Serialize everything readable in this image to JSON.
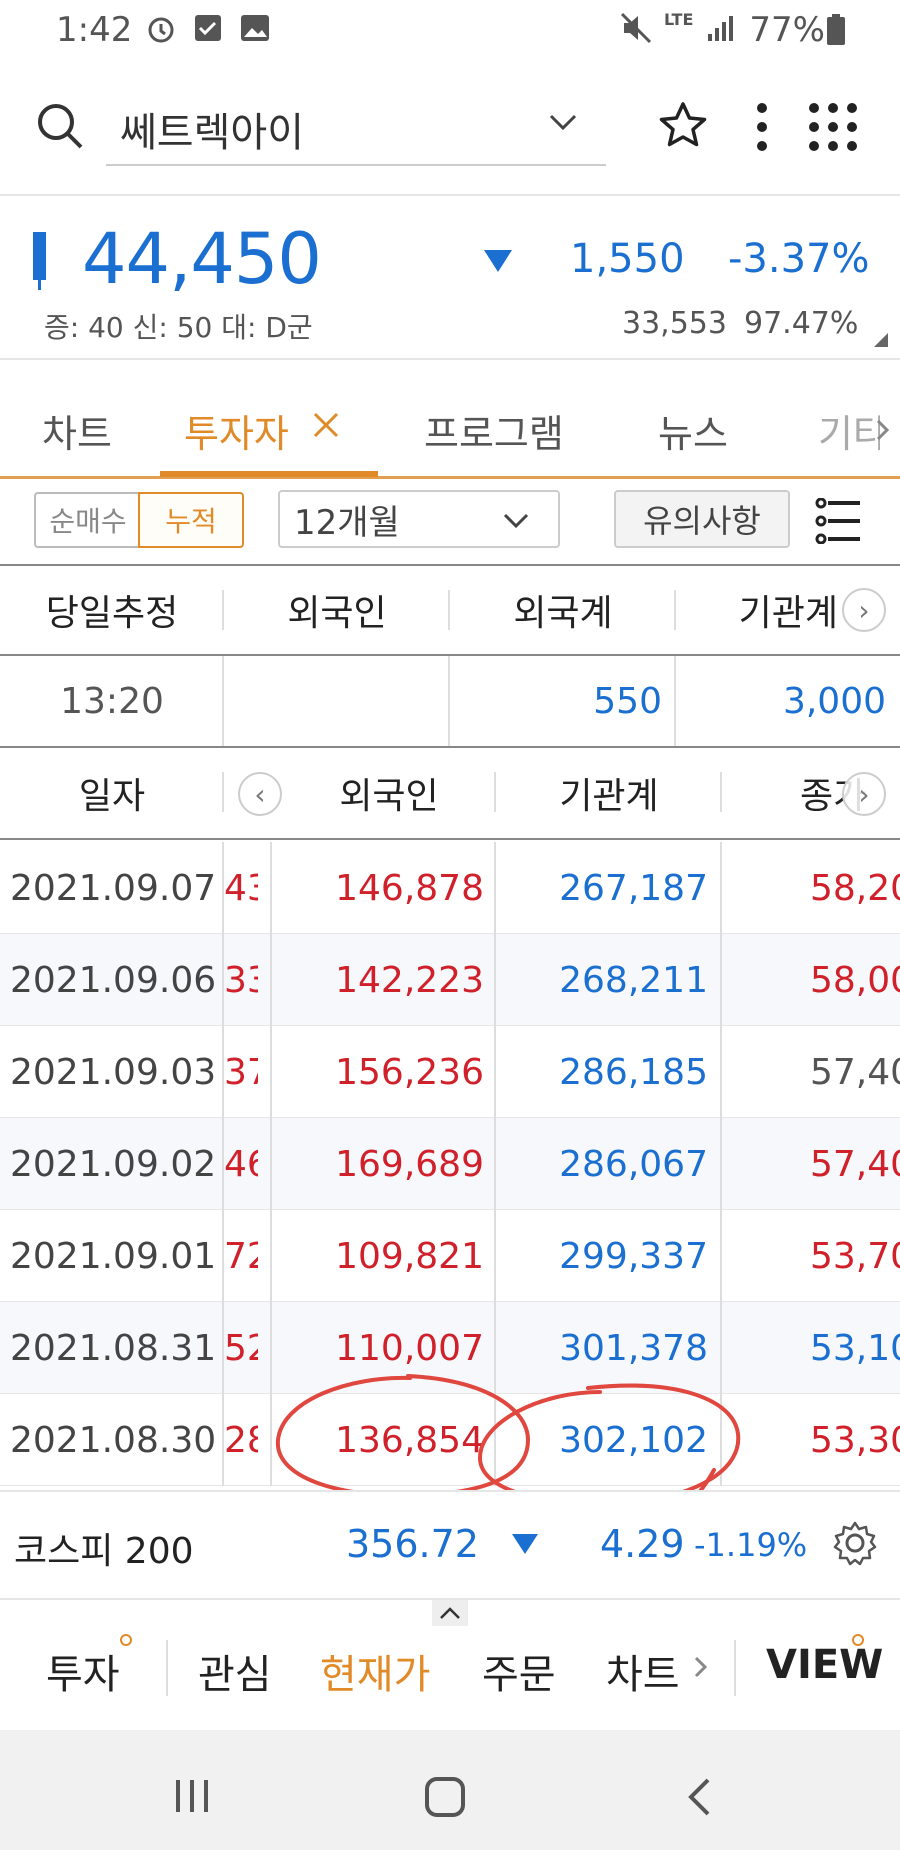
{
  "status_bar": {
    "time": "1:42",
    "network": "LTE",
    "battery": "77%"
  },
  "search": {
    "stock_name": "쎄트렉아이"
  },
  "price": {
    "current": "44,450",
    "change": "1,550",
    "change_pct": "-3.37%",
    "info": "증: 40 신: 50 대: D군",
    "volume": "33,553",
    "ratio": "97.47%"
  },
  "tabs": [
    {
      "label": "차트"
    },
    {
      "label": "투자자"
    },
    {
      "label": "프로그램"
    },
    {
      "label": "뉴스"
    },
    {
      "label": "기타"
    }
  ],
  "filters": {
    "seg_net": "순매수",
    "seg_cum": "누적",
    "period": "12개월",
    "notice": "유의사항"
  },
  "estimate": {
    "headers": [
      "당일추정",
      "외국인",
      "외국계",
      "기관계"
    ],
    "row": {
      "time": "13:20",
      "foreign": "",
      "foreign_firm": "550",
      "institution": "3,000"
    }
  },
  "history": {
    "headers": [
      "일자",
      "외국인",
      "기관계",
      "종가"
    ],
    "rows": [
      {
        "date": "2021.09.07",
        "prev": "43",
        "foreign": "146,878",
        "inst": "267,187",
        "close": "58,20"
      },
      {
        "date": "2021.09.06",
        "prev": "33",
        "foreign": "142,223",
        "inst": "268,211",
        "close": "58,00"
      },
      {
        "date": "2021.09.03",
        "prev": "37",
        "foreign": "156,236",
        "inst": "286,185",
        "close": "57,40"
      },
      {
        "date": "2021.09.02",
        "prev": "46",
        "foreign": "169,689",
        "inst": "286,067",
        "close": "57,40"
      },
      {
        "date": "2021.09.01",
        "prev": "72",
        "foreign": "109,821",
        "inst": "299,337",
        "close": "53,70"
      },
      {
        "date": "2021.08.31",
        "prev": "52",
        "foreign": "110,007",
        "inst": "301,378",
        "close": "53,10"
      },
      {
        "date": "2021.08.30",
        "prev": "28",
        "foreign": "136,854",
        "inst": "302,102",
        "close": "53,30"
      }
    ]
  },
  "index_bar": {
    "name": "코스피 200",
    "value": "356.72",
    "change": "4.29",
    "change_pct": "-1.19%"
  },
  "bottom_nav": [
    "투자",
    "관심",
    "현재가",
    "주문",
    "차트",
    "VIEW"
  ],
  "colors": {
    "up": "#d0202a",
    "down": "#1a6fd1",
    "accent": "#e08a28"
  }
}
